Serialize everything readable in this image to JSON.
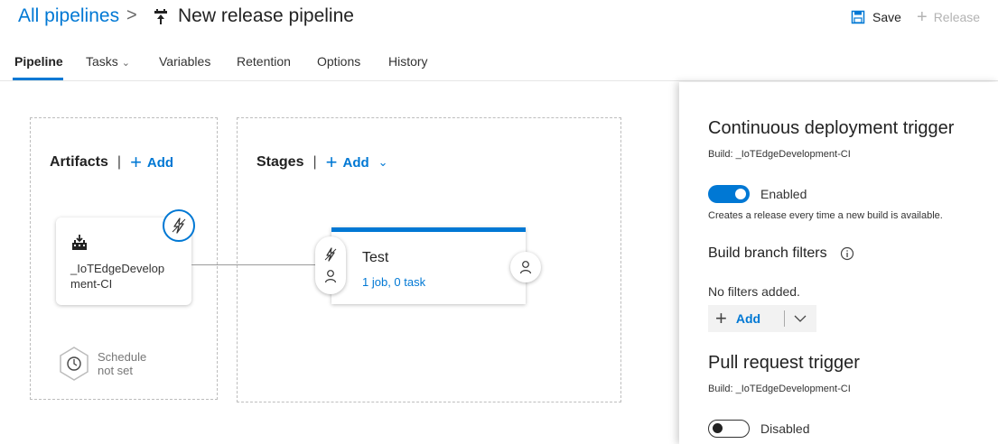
{
  "header": {
    "breadcrumb_root": "All pipelines",
    "breadcrumb_sep": ">",
    "title": "New release pipeline",
    "save_label": "Save",
    "release_label": "Release"
  },
  "tabs": [
    {
      "label": "Pipeline",
      "active": true
    },
    {
      "label": "Tasks",
      "has_dropdown": true
    },
    {
      "label": "Variables"
    },
    {
      "label": "Retention"
    },
    {
      "label": "Options"
    },
    {
      "label": "History"
    }
  ],
  "artifacts": {
    "heading": "Artifacts",
    "separator": "|",
    "add_label": "Add",
    "card_name": "_IoTEdgeDevelopment-CI",
    "card_name_line1": "_IoTEdgeDevelop",
    "card_name_line2": "ment-CI",
    "schedule_line1": "Schedule",
    "schedule_line2": "not set"
  },
  "stages": {
    "heading": "Stages",
    "separator": "|",
    "add_label": "Add",
    "stage_name": "Test",
    "stage_summary": "1 job, 0 task"
  },
  "panel": {
    "cd_heading": "Continuous deployment trigger",
    "cd_build": "Build: _IoTEdgeDevelopment-CI",
    "cd_toggle_label": "Enabled",
    "cd_toggle_on": true,
    "cd_description": "Creates a release every time a new build is available.",
    "branch_filters_label": "Build branch filters",
    "no_filters_text": "No filters added.",
    "add_label": "Add",
    "pr_heading": "Pull request trigger",
    "pr_build": "Build: _IoTEdgeDevelopment-CI",
    "pr_toggle_label": "Disabled",
    "pr_toggle_on": false
  },
  "colors": {
    "accent": "#0078d4",
    "text": "#333333",
    "muted": "#b3b3b3"
  }
}
